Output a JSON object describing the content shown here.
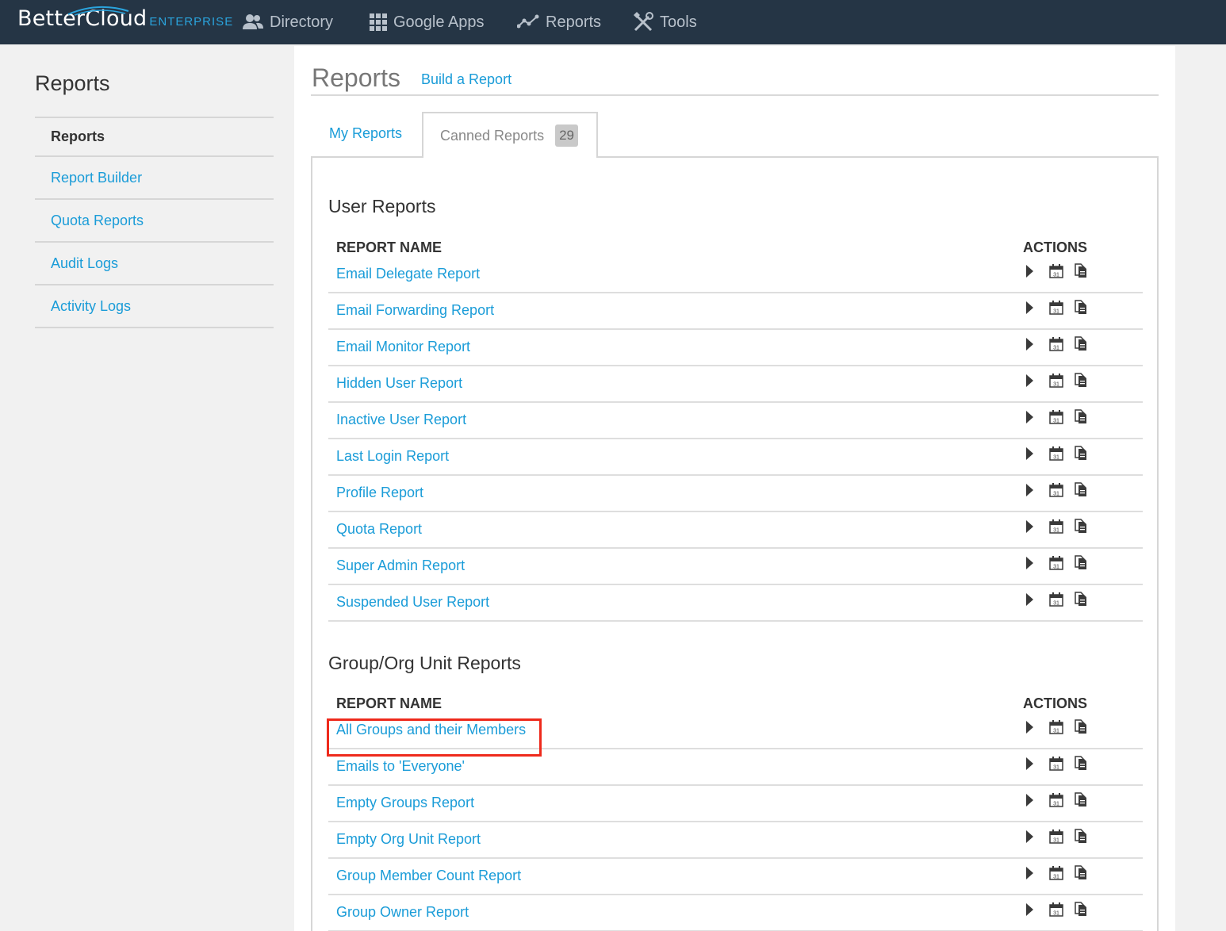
{
  "brand": {
    "name": "BetterCloud",
    "edition": "ENTERPRISE"
  },
  "topnav": [
    {
      "label": "Directory",
      "icon": "users-icon"
    },
    {
      "label": "Google Apps",
      "icon": "grid-icon"
    },
    {
      "label": "Reports",
      "icon": "line-graph-icon"
    },
    {
      "label": "Tools",
      "icon": "tools-icon"
    }
  ],
  "sidebar": {
    "title": "Reports",
    "items": [
      {
        "label": "Reports",
        "active": true
      },
      {
        "label": "Report Builder"
      },
      {
        "label": "Quota Reports"
      },
      {
        "label": "Audit Logs"
      },
      {
        "label": "Activity Logs"
      }
    ]
  },
  "main": {
    "title": "Reports",
    "build_link": "Build a Report",
    "tabs": [
      {
        "label": "My Reports"
      },
      {
        "label": "Canned Reports",
        "badge": "29",
        "active": true
      }
    ],
    "sections": [
      {
        "title": "User Reports",
        "col_name": "REPORT NAME",
        "col_actions": "ACTIONS",
        "rows": [
          "Email Delegate Report",
          "Email Forwarding Report",
          "Email Monitor Report",
          "Hidden User Report",
          "Inactive User Report",
          "Last Login Report",
          "Profile Report",
          "Quota Report",
          "Super Admin Report",
          "Suspended User Report"
        ]
      },
      {
        "title": "Group/Org Unit Reports",
        "col_name": "REPORT NAME",
        "col_actions": "ACTIONS",
        "rows": [
          "All Groups and their Members",
          "Emails to 'Everyone'",
          "Empty Groups Report",
          "Empty Org Unit Report",
          "Group Member Count Report",
          "Group Owner Report"
        ]
      }
    ],
    "action_calendar_day": "31",
    "highlighted_row": "All Groups and their Members",
    "highlight_color": "#ee2a1c"
  }
}
